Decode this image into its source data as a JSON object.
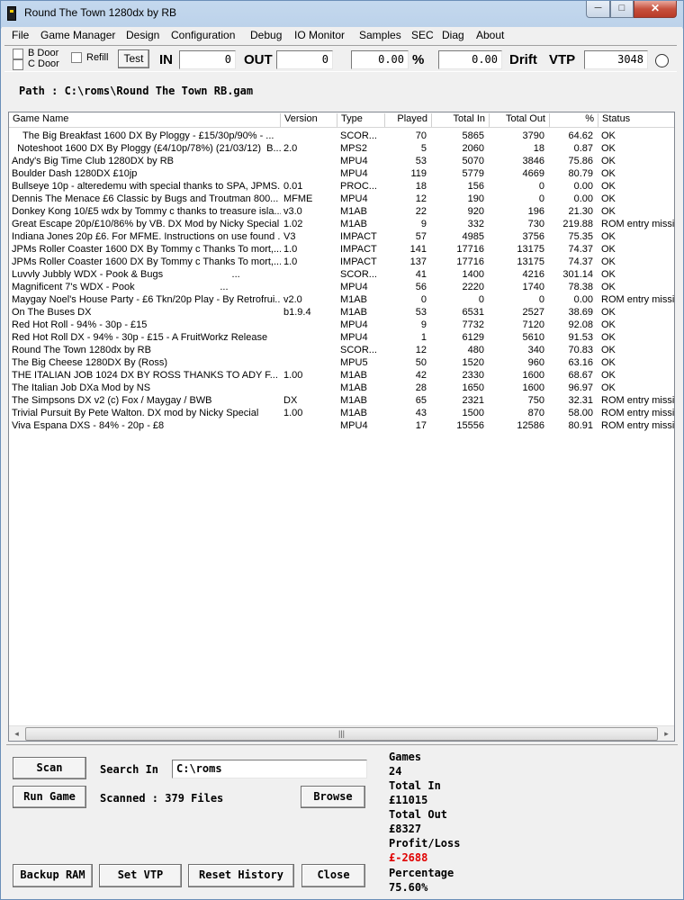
{
  "window": {
    "title": "Round The Town 1280dx by RB",
    "min": "─",
    "max": "□",
    "close": "✕"
  },
  "menu": [
    "File",
    "Game Manager",
    "Design",
    "Configuration",
    "Debug",
    "IO Monitor",
    "Samples",
    "SEC",
    "Diag",
    "About"
  ],
  "toolbar": {
    "b_door": "B Door",
    "c_door": "C Door",
    "refill": "Refill",
    "test": "Test",
    "in_label": "IN",
    "in_value": "0",
    "out_label": "OUT",
    "out_value": "0",
    "pct_value": "0.00",
    "pct_label": "%",
    "drift_value": "0.00",
    "drift_label": "Drift",
    "vtp_label": "VTP",
    "vtp_value": "3048"
  },
  "path": "Path : C:\\roms\\Round The Town RB.gam",
  "columns": [
    "Game Name",
    "Version",
    "Type",
    "Played",
    "Total In",
    "Total Out",
    "%",
    "Status"
  ],
  "games": [
    {
      "name": "    The Big Breakfast 1600 DX By Ploggy - £15/30p/90% - ...",
      "version": "",
      "type": "SCOR...",
      "played": "70",
      "total_in": "5865",
      "total_out": "3790",
      "pct": "64.62",
      "status": "OK"
    },
    {
      "name": "  Noteshoot 1600 DX By Ploggy (£4/10p/78%) (21/03/12)  B...",
      "version": "2.0",
      "type": "MPS2",
      "played": "5",
      "total_in": "2060",
      "total_out": "18",
      "pct": "0.87",
      "status": "OK"
    },
    {
      "name": "Andy's Big Time Club 1280DX by RB",
      "version": "",
      "type": "MPU4",
      "played": "53",
      "total_in": "5070",
      "total_out": "3846",
      "pct": "75.86",
      "status": "OK"
    },
    {
      "name": "Boulder Dash 1280DX £10jp",
      "version": "",
      "type": "MPU4",
      "played": "119",
      "total_in": "5779",
      "total_out": "4669",
      "pct": "80.79",
      "status": "OK"
    },
    {
      "name": "Bullseye 10p - alteredemu with special thanks to SPA, JPMS...",
      "version": "0.01",
      "type": "PROC...",
      "played": "18",
      "total_in": "156",
      "total_out": "0",
      "pct": "0.00",
      "status": "OK"
    },
    {
      "name": "Dennis The Menace £6 Classic by Bugs and Troutman 800...",
      "version": "MFME",
      "type": "MPU4",
      "played": "12",
      "total_in": "190",
      "total_out": "0",
      "pct": "0.00",
      "status": "OK"
    },
    {
      "name": "Donkey Kong 10/£5 wdx by Tommy c thanks to treasure isla...",
      "version": "v3.0",
      "type": "M1AB",
      "played": "22",
      "total_in": "920",
      "total_out": "196",
      "pct": "21.30",
      "status": "OK"
    },
    {
      "name": "Great Escape 20p/£10/86% by VB. DX Mod by Nicky Special",
      "version": "1.02",
      "type": "M1AB",
      "played": "9",
      "total_in": "332",
      "total_out": "730",
      "pct": "219.88",
      "status": "ROM entry missir"
    },
    {
      "name": "Indiana Jones 20p £6. For MFME. Instructions on use found ...",
      "version": "V3",
      "type": "IMPACT",
      "played": "57",
      "total_in": "4985",
      "total_out": "3756",
      "pct": "75.35",
      "status": "OK"
    },
    {
      "name": "JPMs Roller Coaster 1600 DX By Tommy c Thanks To mort,...",
      "version": "1.0",
      "type": "IMPACT",
      "played": "141",
      "total_in": "17716",
      "total_out": "13175",
      "pct": "74.37",
      "status": "OK"
    },
    {
      "name": "JPMs Roller Coaster 1600 DX By Tommy c Thanks To mort,...",
      "version": "1.0",
      "type": "IMPACT",
      "played": "137",
      "total_in": "17716",
      "total_out": "13175",
      "pct": "74.37",
      "status": "OK"
    },
    {
      "name": "Luvvly Jubbly WDX - Pook & Bugs                         ...",
      "version": "",
      "type": "SCOR...",
      "played": "41",
      "total_in": "1400",
      "total_out": "4216",
      "pct": "301.14",
      "status": "OK"
    },
    {
      "name": "Magnificent 7's WDX - Pook                               ...",
      "version": "",
      "type": "MPU4",
      "played": "56",
      "total_in": "2220",
      "total_out": "1740",
      "pct": "78.38",
      "status": "OK"
    },
    {
      "name": "Maygay Noel's House Party - £6 Tkn/20p Play - By Retrofrui...",
      "version": "v2.0",
      "type": "M1AB",
      "played": "0",
      "total_in": "0",
      "total_out": "0",
      "pct": "0.00",
      "status": "ROM entry missir"
    },
    {
      "name": "On The Buses DX",
      "version": "b1.9.4",
      "type": "M1AB",
      "played": "53",
      "total_in": "6531",
      "total_out": "2527",
      "pct": "38.69",
      "status": "OK"
    },
    {
      "name": "Red Hot Roll - 94% - 30p - £15",
      "version": "",
      "type": "MPU4",
      "played": "9",
      "total_in": "7732",
      "total_out": "7120",
      "pct": "92.08",
      "status": "OK"
    },
    {
      "name": "Red Hot Roll DX - 94% - 30p - £15 - A FruitWorkz Release",
      "version": "",
      "type": "MPU4",
      "played": "1",
      "total_in": "6129",
      "total_out": "5610",
      "pct": "91.53",
      "status": "OK"
    },
    {
      "name": "Round The Town 1280dx by RB",
      "version": "",
      "type": "SCOR...",
      "played": "12",
      "total_in": "480",
      "total_out": "340",
      "pct": "70.83",
      "status": "OK"
    },
    {
      "name": "The Big Cheese 1280DX By (Ross)",
      "version": "",
      "type": "MPU5",
      "played": "50",
      "total_in": "1520",
      "total_out": "960",
      "pct": "63.16",
      "status": "OK"
    },
    {
      "name": "THE ITALIAN JOB 1024 DX BY ROSS THANKS TO ADY F...",
      "version": "1.00",
      "type": "M1AB",
      "played": "42",
      "total_in": "2330",
      "total_out": "1600",
      "pct": "68.67",
      "status": "OK"
    },
    {
      "name": "The Italian Job DXa Mod by NS",
      "version": "",
      "type": "M1AB",
      "played": "28",
      "total_in": "1650",
      "total_out": "1600",
      "pct": "96.97",
      "status": "OK"
    },
    {
      "name": "The Simpsons DX v2 (c) Fox / Maygay / BWB",
      "version": "DX",
      "type": "M1AB",
      "played": "65",
      "total_in": "2321",
      "total_out": "750",
      "pct": "32.31",
      "status": "ROM entry missir"
    },
    {
      "name": "Trivial Pursuit By Pete Walton. DX mod by Nicky Special",
      "version": "1.00",
      "type": "M1AB",
      "played": "43",
      "total_in": "1500",
      "total_out": "870",
      "pct": "58.00",
      "status": "ROM entry missir"
    },
    {
      "name": "Viva Espana DXS - 84% - 20p - £8",
      "version": "",
      "type": "MPU4",
      "played": "17",
      "total_in": "15556",
      "total_out": "12586",
      "pct": "80.91",
      "status": "ROM entry missir"
    }
  ],
  "scrollbar": {
    "left": "◂",
    "right": "▸",
    "grip": "|||"
  },
  "bottom": {
    "scan": "Scan",
    "run_game": "Run Game",
    "search_in_label": "Search In",
    "search_in_value": "C:\\roms",
    "scanned": "Scanned : 379 Files",
    "browse": "Browse",
    "backup_ram": "Backup RAM",
    "set_vtp": "Set VTP",
    "reset_history": "Reset History",
    "close": "Close"
  },
  "stats": {
    "games_label": "Games",
    "games_value": "24",
    "total_in_label": "Total In",
    "total_in_value": "£11015",
    "total_out_label": "Total Out",
    "total_out_value": "£8327",
    "profit_label": "Profit/Loss",
    "profit_value": "£-2688",
    "percentage_label": "Percentage",
    "percentage_value": "75.60%"
  },
  "colors": {
    "loss": "#e00000",
    "title_bar": "#c4d8ee",
    "close_button": "#c7503d"
  }
}
